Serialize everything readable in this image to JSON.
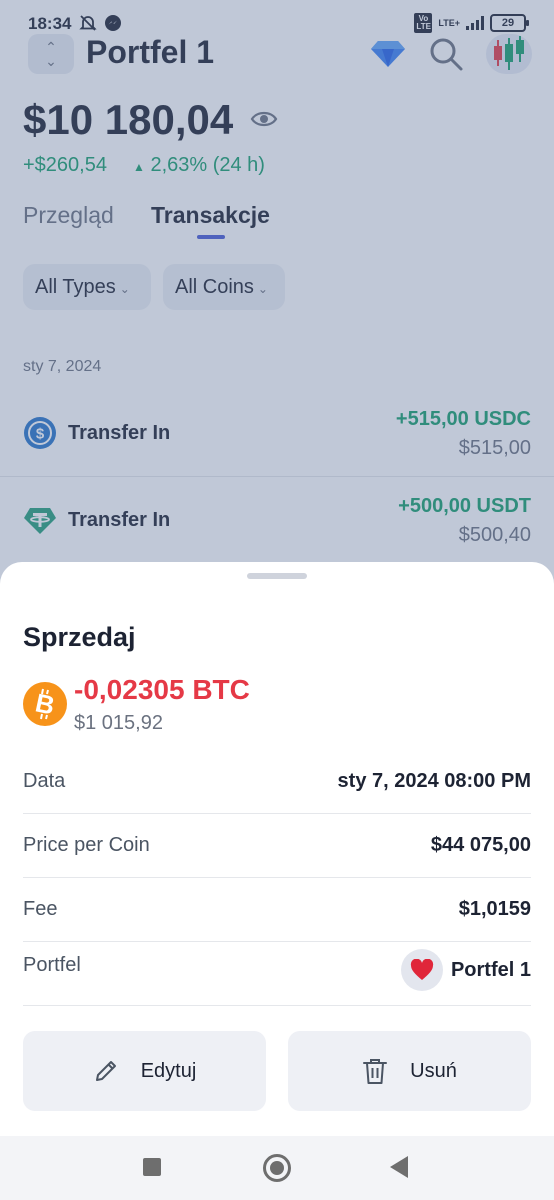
{
  "status_bar": {
    "time": "18:34",
    "volte_label": "Vo LTE",
    "network_label": "LTE+",
    "battery": "29"
  },
  "header": {
    "portfolio_title": "Portfel 1"
  },
  "balance": {
    "total": "$10 180,04",
    "change_abs": "+$260,54",
    "change_pct": "2,63% (24 h)"
  },
  "tabs": [
    {
      "label": "Przegląd",
      "active": false
    },
    {
      "label": "Transakcje",
      "active": true
    }
  ],
  "filters": {
    "types": "All Types",
    "coins": "All Coins"
  },
  "transactions": {
    "date": "sty 7, 2024",
    "items": [
      {
        "icon": "usdc-icon",
        "label": "Transfer In",
        "amount": "+515,00 USDC",
        "fiat": "$515,00"
      },
      {
        "icon": "usdt-icon",
        "label": "Transfer In",
        "amount": "+500,00 USDT",
        "fiat": "$500,40"
      }
    ]
  },
  "sheet": {
    "title": "Sprzedaj",
    "coin_icon": "bitcoin-icon",
    "amount": "-0,02305 BTC",
    "fiat": "$1 015,92",
    "details": {
      "date_label": "Data",
      "date_value": "sty 7, 2024 08:00 PM",
      "price_label": "Price per Coin",
      "price_value": "$44 075,00",
      "fee_label": "Fee",
      "fee_value": "$1,0159",
      "portfolio_label": "Portfel",
      "portfolio_value": "Portfel 1",
      "portfolio_icon": "heart-icon"
    },
    "edit_label": "Edytuj",
    "delete_label": "Usuń"
  },
  "colors": {
    "positive": "#18a06c",
    "negative": "#e53946",
    "accent": "#4a5bd6",
    "bitcoin": "#f7931a"
  }
}
